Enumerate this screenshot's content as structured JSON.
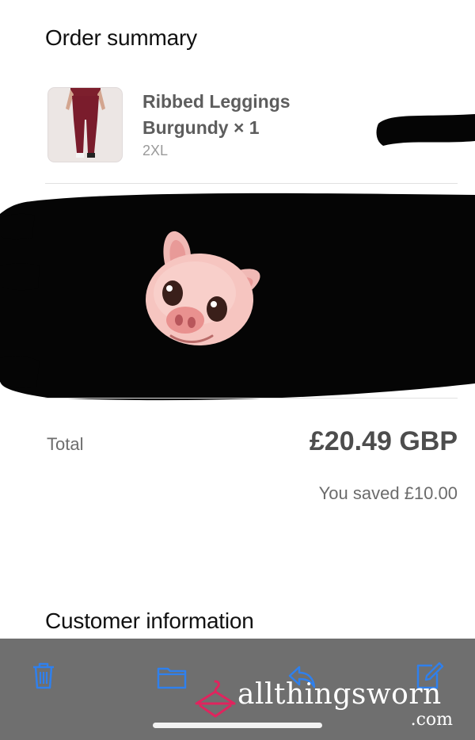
{
  "order_summary": {
    "title": "Order summary",
    "item": {
      "name": "Ribbed Leggings Burgundy × 1",
      "variant": "2XL"
    },
    "total_label": "Total",
    "total_value": "£20.49 GBP",
    "saved": "You saved £10.00"
  },
  "customer_information": {
    "title": "Customer information"
  },
  "toolbar": {
    "icons": [
      "trash-icon",
      "folder-icon",
      "reply-icon",
      "compose-icon"
    ],
    "accent": "#2f80ed"
  },
  "watermark": {
    "text": "allthingsworn",
    "suffix": ".com",
    "accent": "#e0245e"
  }
}
